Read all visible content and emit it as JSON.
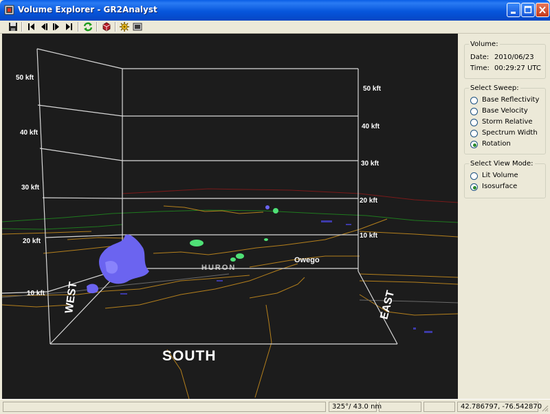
{
  "window": {
    "title": "Volume Explorer - GR2Analyst"
  },
  "toolbar": {
    "buttons": [
      "save",
      "first-frame",
      "previous-frame",
      "next-frame",
      "last-frame",
      "refresh",
      "3d-volume",
      "settings",
      "display"
    ]
  },
  "viewport": {
    "axis_left": [
      "50 kft",
      "40 kft",
      "30 kft",
      "20 kft",
      "10 kft"
    ],
    "axis_right": [
      "50 kft",
      "40 kft",
      "30 kft",
      "20 kft",
      "10 kft"
    ],
    "directions": {
      "south": "SOUTH",
      "east": "EAST",
      "west": "WEST"
    },
    "place_label": "Owego",
    "faded_label": "HURON"
  },
  "volume_panel": {
    "legend": "Volume:",
    "date_label": "Date:",
    "date_value": "2010/06/23",
    "time_label": "Time:",
    "time_value": "00:29:27 UTC"
  },
  "sweep_panel": {
    "legend": "Select Sweep:",
    "options": [
      "Base Reflectivity",
      "Base Velocity",
      "Storm Relative",
      "Spectrum Width",
      "Rotation"
    ],
    "selected": "Rotation"
  },
  "view_panel": {
    "legend": "Select View Mode:",
    "options": [
      "Lit Volume",
      "Isosurface"
    ],
    "selected": "Isosurface"
  },
  "status": {
    "bearing": "325°/ 43.0 nm",
    "coordinates": "42.786797, -76.542870"
  }
}
